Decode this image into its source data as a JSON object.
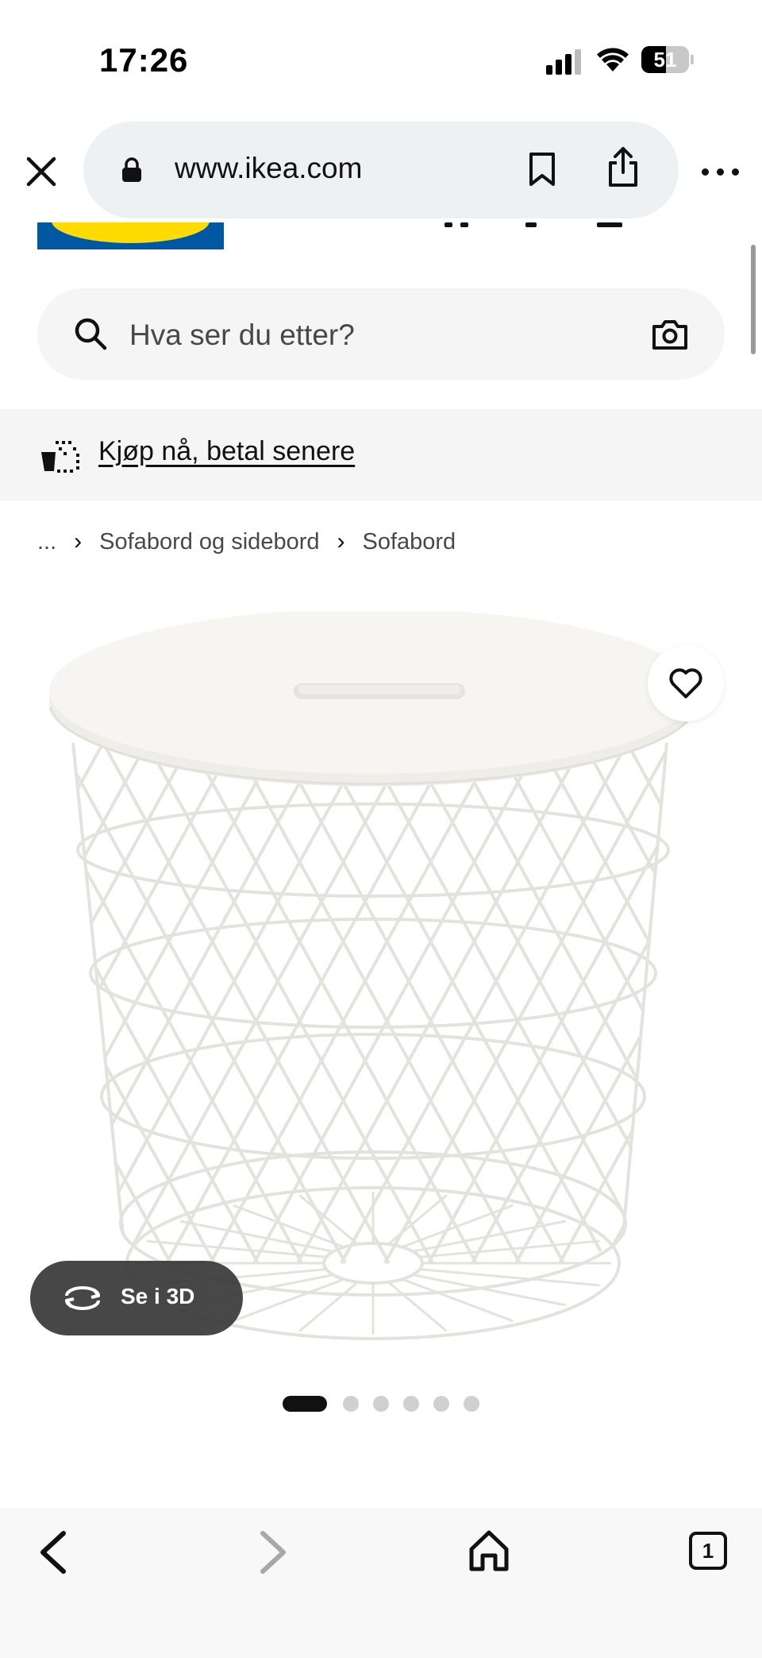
{
  "status_bar": {
    "time": "17:26",
    "battery": "51",
    "battery_level": 0.51
  },
  "browser": {
    "url": "www.ikea.com",
    "open_tabs": "1"
  },
  "search": {
    "placeholder": "Hva ser du etter?"
  },
  "promo": {
    "text": "Kjøp nå, betal senere"
  },
  "breadcrumb": {
    "ellipsis": "...",
    "items": [
      "Sofabord og sidebord",
      "Sofabord"
    ],
    "separator": "›"
  },
  "product": {
    "view_3d_label": "Se i 3D",
    "image_count": 6,
    "current_image": 1
  },
  "colors": {
    "ikea_blue": "#0058a3",
    "ikea_yellow": "#ffdb00",
    "url_pill": "#eef1f4",
    "search_bg": "#f5f5f5"
  }
}
